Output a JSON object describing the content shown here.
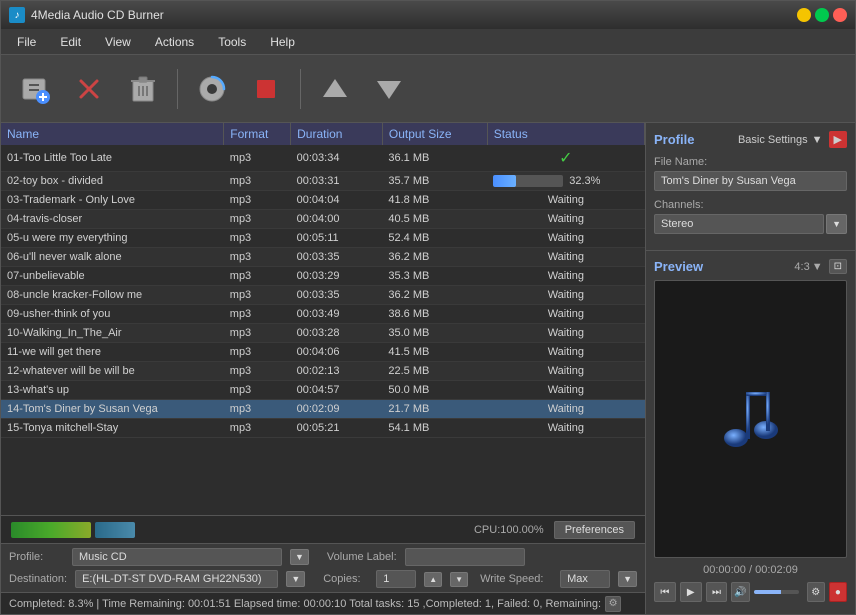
{
  "window": {
    "title": "4Media Audio CD Burner",
    "icon": "♪"
  },
  "menu": {
    "items": [
      "File",
      "Edit",
      "View",
      "Actions",
      "Tools",
      "Help"
    ]
  },
  "toolbar": {
    "buttons": [
      {
        "id": "add",
        "icon": "♪",
        "label": "Add"
      },
      {
        "id": "cancel",
        "icon": "✕",
        "label": "Cancel"
      },
      {
        "id": "delete",
        "icon": "🗑",
        "label": "Delete"
      },
      {
        "id": "convert",
        "icon": "⟳",
        "label": "Convert"
      },
      {
        "id": "stop",
        "icon": "■",
        "label": "Stop"
      },
      {
        "id": "up",
        "icon": "▲",
        "label": "Move Up"
      },
      {
        "id": "down",
        "icon": "▼",
        "label": "Move Down"
      }
    ]
  },
  "table": {
    "headers": [
      "Name",
      "Format",
      "Duration",
      "Output Size",
      "Status"
    ],
    "rows": [
      {
        "id": 1,
        "name": "01-Too Little Too Late",
        "format": "mp3",
        "duration": "00:03:34",
        "size": "36.1 MB",
        "status": "done",
        "selected": false
      },
      {
        "id": 2,
        "name": "02-toy box - divided",
        "format": "mp3",
        "duration": "00:03:31",
        "size": "35.7 MB",
        "status": "progress",
        "progress": 32.3,
        "selected": false
      },
      {
        "id": 3,
        "name": "03-Trademark - Only Love",
        "format": "mp3",
        "duration": "00:04:04",
        "size": "41.8 MB",
        "status": "Waiting",
        "selected": false
      },
      {
        "id": 4,
        "name": "04-travis-closer",
        "format": "mp3",
        "duration": "00:04:00",
        "size": "40.5 MB",
        "status": "Waiting",
        "selected": false
      },
      {
        "id": 5,
        "name": "05-u were my everything",
        "format": "mp3",
        "duration": "00:05:11",
        "size": "52.4 MB",
        "status": "Waiting",
        "selected": false
      },
      {
        "id": 6,
        "name": "06-u'll never walk alone",
        "format": "mp3",
        "duration": "00:03:35",
        "size": "36.2 MB",
        "status": "Waiting",
        "selected": false
      },
      {
        "id": 7,
        "name": "07-unbelievable",
        "format": "mp3",
        "duration": "00:03:29",
        "size": "35.3 MB",
        "status": "Waiting",
        "selected": false
      },
      {
        "id": 8,
        "name": "08-uncle kracker-Follow me",
        "format": "mp3",
        "duration": "00:03:35",
        "size": "36.2 MB",
        "status": "Waiting",
        "selected": false
      },
      {
        "id": 9,
        "name": "09-usher-think of you",
        "format": "mp3",
        "duration": "00:03:49",
        "size": "38.6 MB",
        "status": "Waiting",
        "selected": false
      },
      {
        "id": 10,
        "name": "10-Walking_In_The_Air",
        "format": "mp3",
        "duration": "00:03:28",
        "size": "35.0 MB",
        "status": "Waiting",
        "selected": false
      },
      {
        "id": 11,
        "name": "11-we will get there",
        "format": "mp3",
        "duration": "00:04:06",
        "size": "41.5 MB",
        "status": "Waiting",
        "selected": false
      },
      {
        "id": 12,
        "name": "12-whatever will be will be",
        "format": "mp3",
        "duration": "00:02:13",
        "size": "22.5 MB",
        "status": "Waiting",
        "selected": false
      },
      {
        "id": 13,
        "name": "13-what's up",
        "format": "mp3",
        "duration": "00:04:57",
        "size": "50.0 MB",
        "status": "Waiting",
        "selected": false
      },
      {
        "id": 14,
        "name": "14-Tom's Diner by Susan Vega",
        "format": "mp3",
        "duration": "00:02:09",
        "size": "21.7 MB",
        "status": "Waiting",
        "selected": true
      },
      {
        "id": 15,
        "name": "15-Tonya mitchell-Stay",
        "format": "mp3",
        "duration": "00:05:21",
        "size": "54.1 MB",
        "status": "Waiting",
        "selected": false
      }
    ]
  },
  "footer": {
    "cpu_label": "CPU:100.00%",
    "preferences_btn": "Preferences"
  },
  "bottom_controls": {
    "profile_label": "Profile:",
    "profile_value": "Music CD",
    "volume_label_label": "Volume Label:",
    "volume_label_value": "",
    "destination_label": "Destination:",
    "destination_value": "E:(HL-DT-ST DVD-RAM GH22N530)",
    "copies_label": "Copies:",
    "copies_value": "1",
    "write_speed_label": "Write Speed:",
    "write_speed_value": "Max"
  },
  "status_bar": {
    "text": "Completed: 8.3%  | Time Remaining: 00:01:51  Elapsed time: 00:00:10  Total tasks: 15 ,Completed: 1, Failed: 0, Remaining:"
  },
  "right_panel": {
    "profile_title": "Profile",
    "basic_settings_label": "Basic Settings",
    "file_name_label": "File Name:",
    "file_name_value": "Tom's Diner by Susan Vega",
    "channels_label": "Channels:",
    "channels_value": "Stereo",
    "preview_title": "Preview",
    "aspect_ratio": "4:3",
    "time_display": "00:00:00 / 00:02:09",
    "music_note": "🎵",
    "player_buttons": [
      "⏮",
      "▶",
      "⏭",
      "🔊"
    ]
  }
}
